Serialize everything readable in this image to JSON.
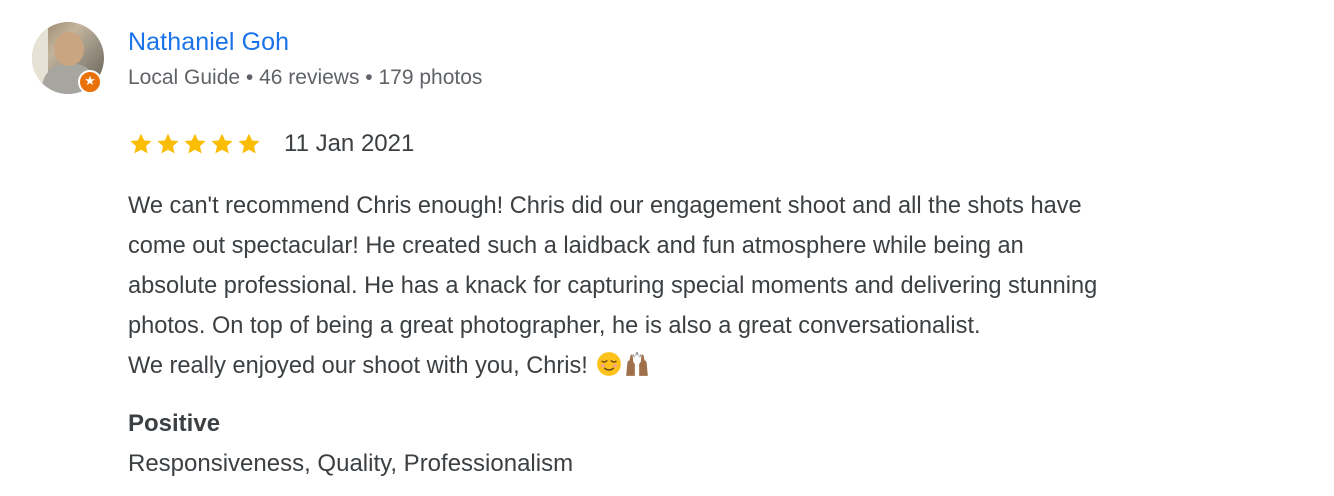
{
  "reviewer": {
    "name": "Nathaniel Goh",
    "meta": "Local Guide • 46 reviews • 179 photos",
    "badge_icon": "local-guide-star-icon",
    "badge_color": "#e8710a"
  },
  "review": {
    "rating": 5,
    "rating_max": 5,
    "star_color": "#fbbc04",
    "date": "11 Jan 2021",
    "lines": [
      "We can't recommend Chris enough! Chris did our engagement shoot and all the shots have",
      "come out spectacular! He created such a laidback and fun atmosphere while being an",
      "absolute professional. He has a knack for capturing special moments and delivering stunning",
      "photos. On top of being a great photographer, he is also a great conversationalist.",
      "We really enjoyed our shoot with you, Chris!"
    ],
    "emojis": [
      "relieved-face-emoji",
      "raising-hands-emoji"
    ]
  },
  "attributes": {
    "heading": "Positive",
    "items": "Responsiveness, Quality, Professionalism"
  },
  "colors": {
    "name_link": "#1a73e8",
    "secondary_text": "#5f6368",
    "body_text": "#3c4043"
  }
}
